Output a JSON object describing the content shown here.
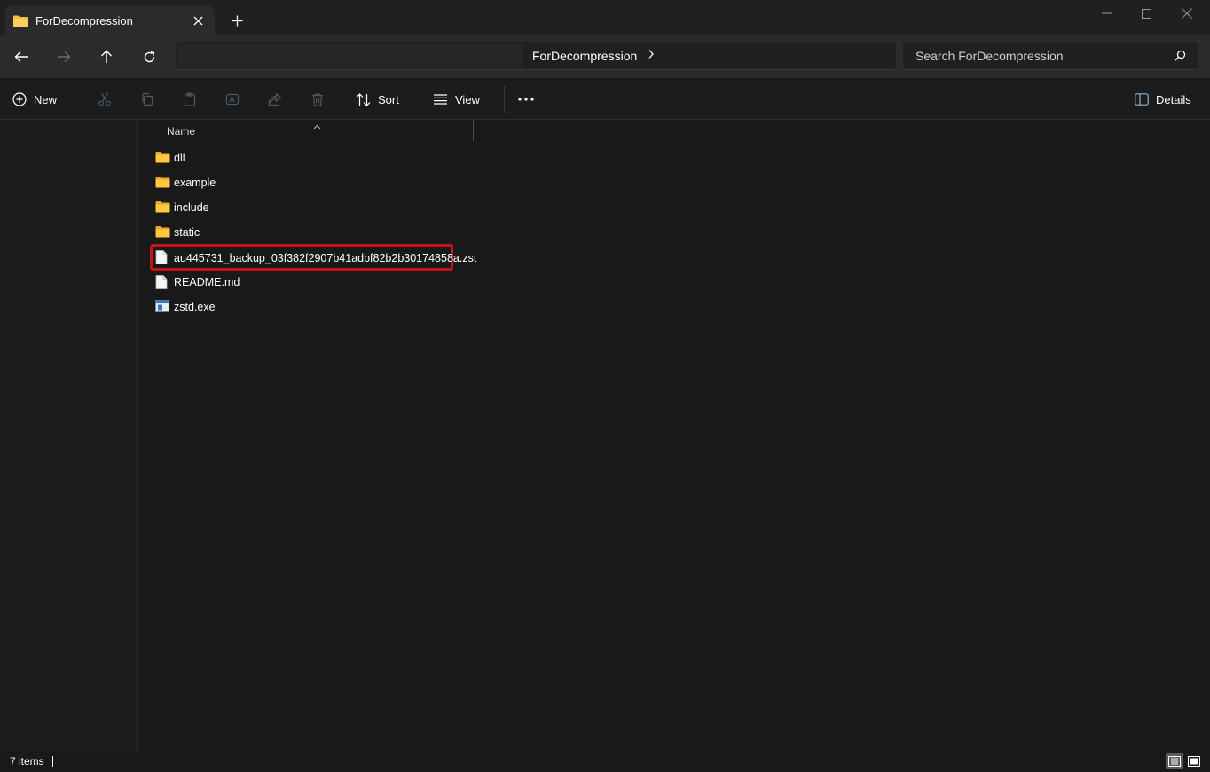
{
  "window": {
    "tab_title": "ForDecompression"
  },
  "address": {
    "path": "ForDecompression"
  },
  "search": {
    "placeholder": "Search ForDecompression"
  },
  "commands": {
    "new_label": "New",
    "sort_label": "Sort",
    "view_label": "View",
    "details_label": "Details"
  },
  "columns": {
    "name": "Name"
  },
  "files": [
    {
      "name": "dll",
      "type": "folder",
      "icon": "folder-icon"
    },
    {
      "name": "example",
      "type": "folder",
      "icon": "folder-icon"
    },
    {
      "name": "include",
      "type": "folder",
      "icon": "folder-icon"
    },
    {
      "name": "static",
      "type": "folder",
      "icon": "folder-icon"
    },
    {
      "name": "au445731_backup_03f382f2907b41adbf82b2b30174858a.zst",
      "type": "file",
      "icon": "file-icon",
      "highlighted": true
    },
    {
      "name": "README.md",
      "type": "file",
      "icon": "file-icon"
    },
    {
      "name": "zstd.exe",
      "type": "exe",
      "icon": "exe-icon"
    }
  ],
  "status": {
    "item_count": "7 items"
  },
  "colors": {
    "folder": "#f3c03d",
    "highlight": "#c4141a",
    "background": "#191919"
  }
}
